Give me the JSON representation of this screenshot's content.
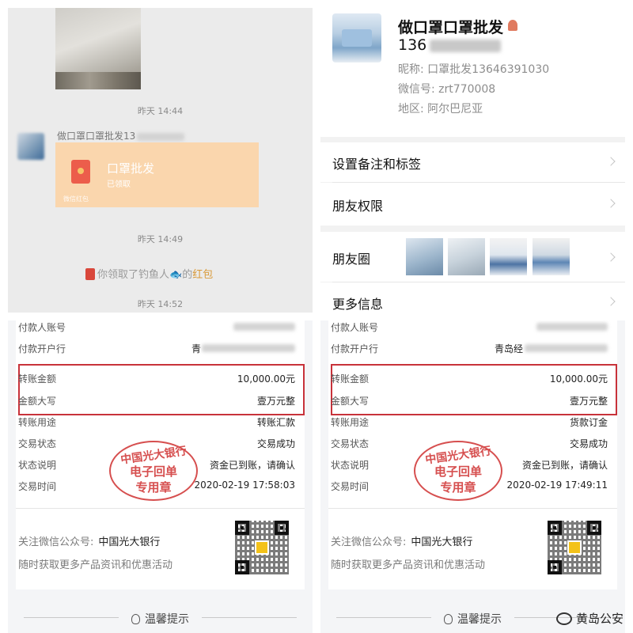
{
  "chat": {
    "time_1": "昨天 14:44",
    "sender_name": "做口罩口罩批发13",
    "red_packet": {
      "title": "口罩批发",
      "status": "已领取",
      "footer": "微信红包"
    },
    "time_2": "昨天 14:49",
    "notice": {
      "prefix": "你领取了钓鱼人",
      "fish": "🐟",
      "middle": "的",
      "link": "红包"
    },
    "time_3": "昨天 14:52"
  },
  "profile": {
    "name": "做口罩口罩批发",
    "id_prefix": "136",
    "nickname": "昵称: 口罩批发13646391030",
    "wechat_id": "微信号: zrt770008",
    "region": "地区: 阿尔巴尼亚",
    "menu": {
      "remark": "设置备注和标签",
      "permissions": "朋友权限",
      "moments": "朋友圈",
      "more_info": "更多信息"
    }
  },
  "receipts": [
    {
      "payer_account_label": "付款人账号",
      "payer_bank_label": "付款开户行",
      "payer_bank_value": "青",
      "amount_label": "转账金额",
      "amount_value": "10,000.00元",
      "amount_upper_label": "金额大写",
      "amount_upper_value": "壹万元整",
      "purpose_label": "转账用途",
      "purpose_value": "转账汇款",
      "status_label": "交易状态",
      "status_value": "交易成功",
      "desc_label": "状态说明",
      "desc_value": "资金已到账，请确认",
      "time_label": "交易时间",
      "time_value": "2020-02-19  17:58:03",
      "stamp": {
        "line1": "中国光大银行",
        "line2": "电子回单",
        "line3": "专用章"
      },
      "follow_label": "关注微信公众号:",
      "follow_value": "中国光大银行",
      "promo": "随时获取更多产品资讯和优惠活动",
      "tip": "温馨提示"
    },
    {
      "payer_account_label": "付款人账号",
      "payer_bank_label": "付款开户行",
      "payer_bank_value": "青岛经",
      "amount_label": "转账金额",
      "amount_value": "10,000.00元",
      "amount_upper_label": "金额大写",
      "amount_upper_value": "壹万元整",
      "purpose_label": "转账用途",
      "purpose_value": "货款订金",
      "status_label": "交易状态",
      "status_value": "交易成功",
      "desc_label": "状态说明",
      "desc_value": "资金已到账，请确认",
      "time_label": "交易时间",
      "time_value": "2020-02-19  17:49:11",
      "stamp": {
        "line1": "中国光大银行",
        "line2": "电子回单",
        "line3": "专用章"
      },
      "follow_label": "关注微信公众号:",
      "follow_value": "中国光大银行",
      "promo": "随时获取更多产品资讯和优惠活动",
      "tip": "温馨提示"
    }
  ],
  "watermark": "黄岛公安",
  "colors": {
    "highlight": "#c8323a",
    "stamp": "#d23c3c",
    "red_packet": "#fad6ad"
  }
}
